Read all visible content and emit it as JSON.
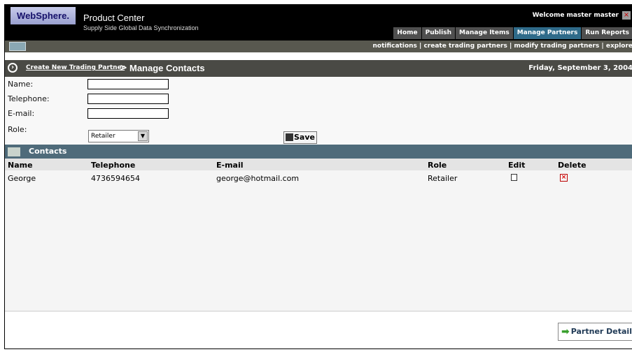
{
  "header": {
    "logo": "WebSphere.",
    "product": "Product Center",
    "subtitle": "Supply Side Global Data Synchronization",
    "welcome": "Welcome  master master",
    "tabs": [
      "Home",
      "Publish",
      "Manage Items",
      "Manage Partners",
      "Run Reports"
    ],
    "active_tab": "Manage Partners"
  },
  "subnav": {
    "links": "notifications  |  create trading partners  |  modify trading partners  |  explore"
  },
  "breadcrumb": {
    "link": "Create New Trading Partner",
    "separator": ">",
    "title": "Manage Contacts",
    "date": "Friday, September 3, 2004"
  },
  "form": {
    "name_label": "Name:",
    "telephone_label": "Telephone:",
    "email_label": "E-mail:",
    "role_label": "Role:",
    "name_value": "",
    "telephone_value": "",
    "email_value": "",
    "role_selected": "Retailer",
    "save_label": "Save"
  },
  "contacts": {
    "title": "Contacts",
    "columns": [
      "Name",
      "Telephone",
      "E-mail",
      "Role",
      "Edit",
      "Delete"
    ],
    "rows": [
      {
        "name": "George",
        "telephone": "4736594654",
        "email": "george@hotmail.com",
        "role": "Retailer"
      }
    ]
  },
  "footer": {
    "partner_details_label": "Partner Details"
  },
  "colors": {
    "accent": "#4f6b7a",
    "header_bg": "#000000",
    "active_tab": "#2f6b8a"
  }
}
